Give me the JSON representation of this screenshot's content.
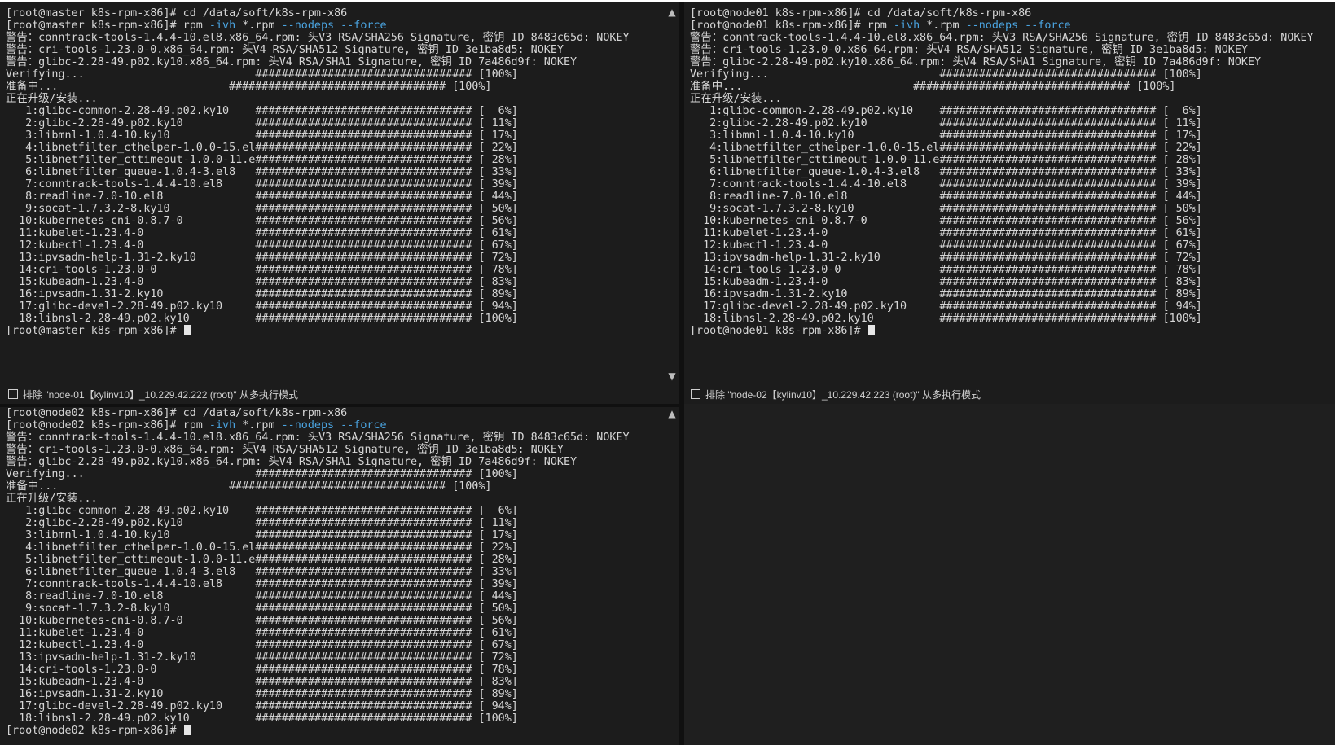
{
  "panes": [
    {
      "id": "master",
      "lines": [
        {
          "text": "[root@master k8s-rpm-x86]# cd /data/soft/k8s-rpm-x86"
        },
        {
          "parts": [
            {
              "t": "[root@master k8s-rpm-x86]# rpm "
            },
            {
              "t": "-ivh",
              "c": "flag"
            },
            {
              "t": " *.rpm "
            },
            {
              "t": "--nodeps --force",
              "c": "flag"
            }
          ]
        },
        {
          "text": "警告：conntrack-tools-1.4.4-10.el8.x86_64.rpm: 头V3 RSA/SHA256 Signature, 密钥 ID 8483c65d: NOKEY"
        },
        {
          "text": "警告：cri-tools-1.23.0-0.x86_64.rpm: 头V4 RSA/SHA512 Signature, 密钥 ID 3e1ba8d5: NOKEY"
        },
        {
          "text": "警告：glibc-2.28-49.p02.ky10.x86_64.rpm: 头V4 RSA/SHA1 Signature, 密钥 ID 7a486d9f: NOKEY"
        },
        {
          "text": "Verifying...                          ################################# [100%]"
        },
        {
          "text": "准备中...                          ################################# [100%]"
        },
        {
          "text": "正在升级/安装..."
        },
        {
          "text": "   1:glibc-common-2.28-49.p02.ky10    ################################# [  6%]"
        },
        {
          "text": "   2:glibc-2.28-49.p02.ky10           ################################# [ 11%]"
        },
        {
          "text": "   3:libmnl-1.0.4-10.ky10             ################################# [ 17%]"
        },
        {
          "text": "   4:libnetfilter_cthelper-1.0.0-15.el################################# [ 22%]"
        },
        {
          "text": "   5:libnetfilter_cttimeout-1.0.0-11.e################################# [ 28%]"
        },
        {
          "text": "   6:libnetfilter_queue-1.0.4-3.el8   ################################# [ 33%]"
        },
        {
          "text": "   7:conntrack-tools-1.4.4-10.el8     ################################# [ 39%]"
        },
        {
          "text": "   8:readline-7.0-10.el8              ################################# [ 44%]"
        },
        {
          "text": "   9:socat-1.7.3.2-8.ky10             ################################# [ 50%]"
        },
        {
          "text": "  10:kubernetes-cni-0.8.7-0           ################################# [ 56%]"
        },
        {
          "text": "  11:kubelet-1.23.4-0                 ################################# [ 61%]"
        },
        {
          "text": "  12:kubectl-1.23.4-0                 ################################# [ 67%]"
        },
        {
          "text": "  13:ipvsadm-help-1.31-2.ky10         ################################# [ 72%]"
        },
        {
          "text": "  14:cri-tools-1.23.0-0               ################################# [ 78%]"
        },
        {
          "text": "  15:kubeadm-1.23.4-0                 ################################# [ 83%]"
        },
        {
          "text": "  16:ipvsadm-1.31-2.ky10              ################################# [ 89%]"
        },
        {
          "text": "  17:glibc-devel-2.28-49.p02.ky10     ################################# [ 94%]"
        },
        {
          "text": "  18:libnsl-2.28-49.p02.ky10          ################################# [100%]"
        },
        {
          "text": "[root@master k8s-rpm-x86]# ",
          "cursor": true
        }
      ],
      "exclude_label": "排除 \"node-01【kylinv10】_10.229.42.222 (root)\" 从多执行模式"
    },
    {
      "id": "node01",
      "lines": [
        {
          "text": "[root@node01 k8s-rpm-x86]# cd /data/soft/k8s-rpm-x86"
        },
        {
          "parts": [
            {
              "t": "[root@node01 k8s-rpm-x86]# rpm "
            },
            {
              "t": "-ivh",
              "c": "flag"
            },
            {
              "t": " *.rpm "
            },
            {
              "t": "--nodeps --force",
              "c": "flag"
            }
          ]
        },
        {
          "text": "警告：conntrack-tools-1.4.4-10.el8.x86_64.rpm: 头V3 RSA/SHA256 Signature, 密钥 ID 8483c65d: NOKEY"
        },
        {
          "text": "警告：cri-tools-1.23.0-0.x86_64.rpm: 头V4 RSA/SHA512 Signature, 密钥 ID 3e1ba8d5: NOKEY"
        },
        {
          "text": "警告：glibc-2.28-49.p02.ky10.x86_64.rpm: 头V4 RSA/SHA1 Signature, 密钥 ID 7a486d9f: NOKEY"
        },
        {
          "text": "Verifying...                          ################################# [100%]"
        },
        {
          "text": "准备中...                          ################################# [100%]"
        },
        {
          "text": "正在升级/安装..."
        },
        {
          "text": "   1:glibc-common-2.28-49.p02.ky10    ################################# [  6%]"
        },
        {
          "text": "   2:glibc-2.28-49.p02.ky10           ################################# [ 11%]"
        },
        {
          "text": "   3:libmnl-1.0.4-10.ky10             ################################# [ 17%]"
        },
        {
          "text": "   4:libnetfilter_cthelper-1.0.0-15.el################################# [ 22%]"
        },
        {
          "text": "   5:libnetfilter_cttimeout-1.0.0-11.e################################# [ 28%]"
        },
        {
          "text": "   6:libnetfilter_queue-1.0.4-3.el8   ################################# [ 33%]"
        },
        {
          "text": "   7:conntrack-tools-1.4.4-10.el8     ################################# [ 39%]"
        },
        {
          "text": "   8:readline-7.0-10.el8              ################################# [ 44%]"
        },
        {
          "text": "   9:socat-1.7.3.2-8.ky10             ################################# [ 50%]"
        },
        {
          "text": "  10:kubernetes-cni-0.8.7-0           ################################# [ 56%]"
        },
        {
          "text": "  11:kubelet-1.23.4-0                 ################################# [ 61%]"
        },
        {
          "text": "  12:kubectl-1.23.4-0                 ################################# [ 67%]"
        },
        {
          "text": "  13:ipvsadm-help-1.31-2.ky10         ################################# [ 72%]"
        },
        {
          "text": "  14:cri-tools-1.23.0-0               ################################# [ 78%]"
        },
        {
          "text": "  15:kubeadm-1.23.4-0                 ################################# [ 83%]"
        },
        {
          "text": "  16:ipvsadm-1.31-2.ky10              ################################# [ 89%]"
        },
        {
          "text": "  17:glibc-devel-2.28-49.p02.ky10     ################################# [ 94%]"
        },
        {
          "text": "  18:libnsl-2.28-49.p02.ky10          ################################# [100%]"
        },
        {
          "text": "[root@node01 k8s-rpm-x86]# ",
          "cursor": true
        }
      ],
      "exclude_label": "排除 \"node-02【kylinv10】_10.229.42.223 (root)\" 从多执行模式"
    },
    {
      "id": "node02",
      "lines": [
        {
          "text": "[root@node02 k8s-rpm-x86]# cd /data/soft/k8s-rpm-x86"
        },
        {
          "parts": [
            {
              "t": "[root@node02 k8s-rpm-x86]# rpm "
            },
            {
              "t": "-ivh",
              "c": "flag"
            },
            {
              "t": " *.rpm "
            },
            {
              "t": "--nodeps --force",
              "c": "flag"
            }
          ]
        },
        {
          "text": "警告：conntrack-tools-1.4.4-10.el8.x86_64.rpm: 头V3 RSA/SHA256 Signature, 密钥 ID 8483c65d: NOKEY"
        },
        {
          "text": "警告：cri-tools-1.23.0-0.x86_64.rpm: 头V4 RSA/SHA512 Signature, 密钥 ID 3e1ba8d5: NOKEY"
        },
        {
          "text": "警告：glibc-2.28-49.p02.ky10.x86_64.rpm: 头V4 RSA/SHA1 Signature, 密钥 ID 7a486d9f: NOKEY"
        },
        {
          "text": "Verifying...                          ################################# [100%]"
        },
        {
          "text": "准备中...                          ################################# [100%]"
        },
        {
          "text": "正在升级/安装..."
        },
        {
          "text": "   1:glibc-common-2.28-49.p02.ky10    ################################# [  6%]"
        },
        {
          "text": "   2:glibc-2.28-49.p02.ky10           ################################# [ 11%]"
        },
        {
          "text": "   3:libmnl-1.0.4-10.ky10             ################################# [ 17%]"
        },
        {
          "text": "   4:libnetfilter_cthelper-1.0.0-15.el################################# [ 22%]"
        },
        {
          "text": "   5:libnetfilter_cttimeout-1.0.0-11.e################################# [ 28%]"
        },
        {
          "text": "   6:libnetfilter_queue-1.0.4-3.el8   ################################# [ 33%]"
        },
        {
          "text": "   7:conntrack-tools-1.4.4-10.el8     ################################# [ 39%]"
        },
        {
          "text": "   8:readline-7.0-10.el8              ################################# [ 44%]"
        },
        {
          "text": "   9:socat-1.7.3.2-8.ky10             ################################# [ 50%]"
        },
        {
          "text": "  10:kubernetes-cni-0.8.7-0           ################################# [ 56%]"
        },
        {
          "text": "  11:kubelet-1.23.4-0                 ################################# [ 61%]"
        },
        {
          "text": "  12:kubectl-1.23.4-0                 ################################# [ 67%]"
        },
        {
          "text": "  13:ipvsadm-help-1.31-2.ky10         ################################# [ 72%]"
        },
        {
          "text": "  14:cri-tools-1.23.0-0               ################################# [ 78%]"
        },
        {
          "text": "  15:kubeadm-1.23.4-0                 ################################# [ 83%]"
        },
        {
          "text": "  16:ipvsadm-1.31-2.ky10              ################################# [ 89%]"
        },
        {
          "text": "  17:glibc-devel-2.28-49.p02.ky10     ################################# [ 94%]"
        },
        {
          "text": "  18:libnsl-2.28-49.p02.ky10          ################################# [100%]"
        },
        {
          "text": "[root@node02 k8s-rpm-x86]# ",
          "cursor": true
        }
      ]
    }
  ],
  "icons": {
    "scroll_up": "▲",
    "scroll_down": "▼"
  },
  "colors": {
    "background": "#1c1c1c",
    "text": "#d6d6d6",
    "flag": "#4aa3df"
  }
}
